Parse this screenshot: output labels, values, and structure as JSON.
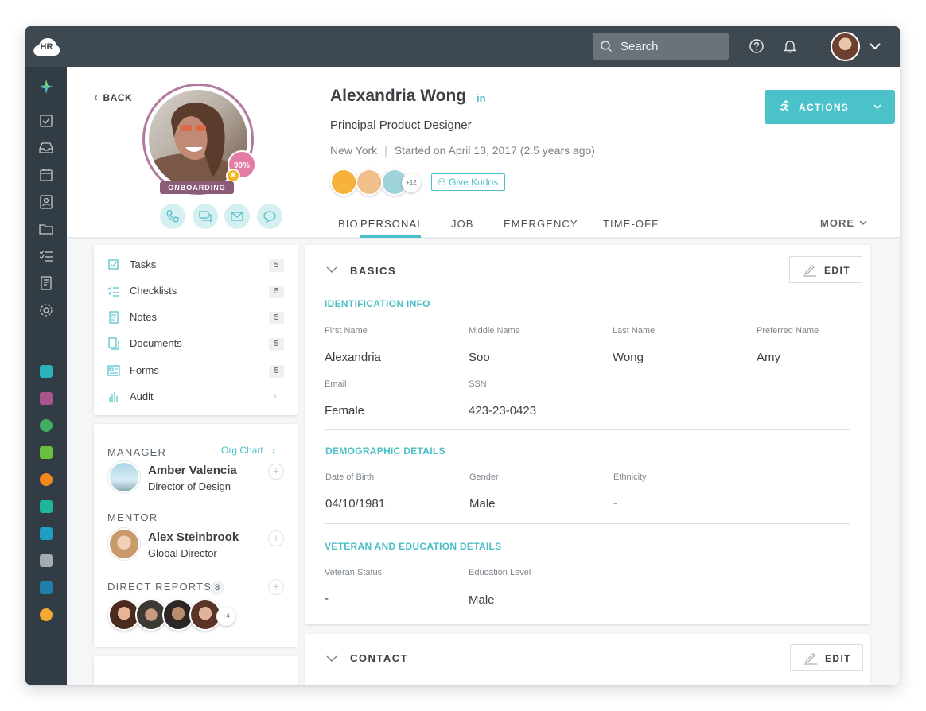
{
  "app": {
    "logo_text": "HR"
  },
  "topbar": {
    "search_placeholder": "Search"
  },
  "profile": {
    "back_label": "BACK",
    "name": "Alexandria Wong",
    "linkedin": "in",
    "title": "Principal Product Designer",
    "location": "New York",
    "separator": "|",
    "started": "Started on April 13, 2017 (2.5 years ago)",
    "completion": "90%",
    "status_badge": "ONBOARDING",
    "kudos_more": "+12",
    "give_kudos": "Give Kudos",
    "actions_label": "ACTIONS"
  },
  "tabs": [
    {
      "label": "BIO"
    },
    {
      "label": "PERSONAL",
      "active": true
    },
    {
      "label": "JOB"
    },
    {
      "label": "EMERGENCY"
    },
    {
      "label": "TIME-OFF"
    }
  ],
  "more_label": "MORE",
  "side_menu": [
    {
      "label": "Tasks",
      "count": "5",
      "icon": "check-square-icon"
    },
    {
      "label": "Checklists",
      "count": "5",
      "icon": "checklist-icon"
    },
    {
      "label": "Notes",
      "count": "5",
      "icon": "note-icon"
    },
    {
      "label": "Documents",
      "count": "5",
      "icon": "documents-icon"
    },
    {
      "label": "Forms",
      "count": "5",
      "icon": "form-icon"
    },
    {
      "label": "Audit",
      "count": "",
      "icon": "audit-icon"
    }
  ],
  "people": {
    "manager_label": "MANAGER",
    "org_chart": "Org Chart",
    "manager": {
      "name": "Amber Valencia",
      "role": "Director of Design"
    },
    "mentor_label": "MENTOR",
    "mentor": {
      "name": "Alex Steinbrook",
      "role": "Global Director"
    },
    "direct_reports_label": "DIRECT REPORTS",
    "direct_reports_count": "8",
    "direct_reports_more": "+4"
  },
  "basics": {
    "title": "BASICS",
    "edit_label": "EDIT",
    "identification": {
      "heading": "IDENTIFICATION INFO",
      "first_name_label": "First Name",
      "first_name": "Alexandria",
      "middle_name_label": "Middle Name",
      "middle_name": "Soo",
      "last_name_label": "Last Name",
      "last_name": "Wong",
      "preferred_name_label": "Preferred Name",
      "preferred_name": "Amy",
      "email_label": "Email",
      "email": "Female",
      "ssn_label": "SSN",
      "ssn": "423-23-0423"
    },
    "demographic": {
      "heading": "DEMOGRAPHIC DETAILS",
      "dob_label": "Date of Birth",
      "dob": "04/10/1981",
      "gender_label": "Gender",
      "gender": "Male",
      "ethnicity_label": "Ethnicity",
      "ethnicity": "-"
    },
    "veteran": {
      "heading": "VETERAN AND EDUCATION DETAILS",
      "veteran_label": "Veteran Status",
      "veteran": "-",
      "education_label": "Education Level",
      "education": "Male"
    }
  },
  "contact": {
    "title": "CONTACT",
    "edit_label": "EDIT"
  },
  "colors": {
    "accent": "#4bbfc7",
    "topbar": "#3e4850",
    "rail": "#313c44",
    "badge": "#8a5c78",
    "completion": "#e27ba5"
  }
}
